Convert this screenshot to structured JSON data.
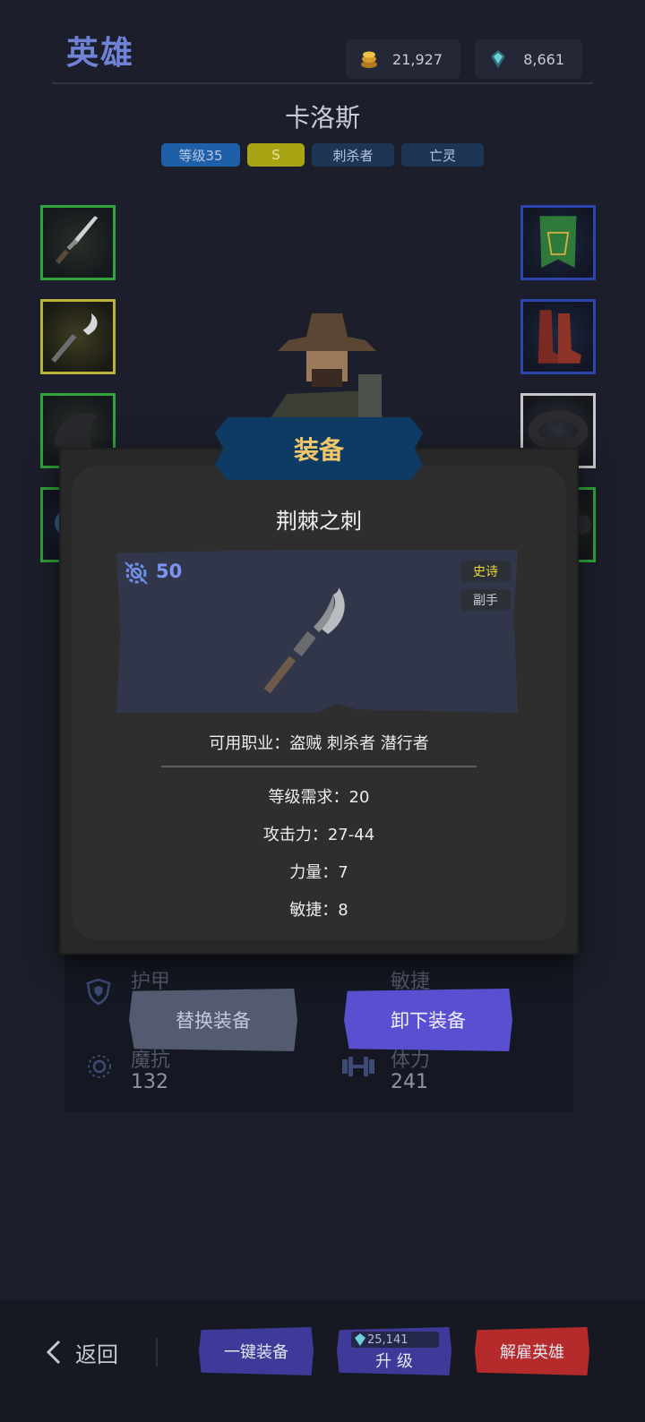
{
  "header": {
    "title": "英雄",
    "gold": "21,927",
    "gems": "8,661"
  },
  "hero": {
    "name": "卡洛斯",
    "tags": [
      "等级35",
      "S",
      "刺杀者",
      "亡灵"
    ]
  },
  "stats_behind": {
    "armor_label": "护甲",
    "agility_label": "敏捷",
    "magic_resist_label": "魔抗",
    "magic_resist_value": "132",
    "stamina_label": "体力",
    "stamina_value": "241"
  },
  "modal": {
    "title": "装备",
    "item_name": "荆棘之刺",
    "item_level": "50",
    "rarity": "史诗",
    "slot_type": "副手",
    "classes": "可用职业：盗贼  刺杀者  潜行者",
    "stats": [
      "等级需求：20",
      "攻击力：27-44",
      "力量：7",
      "敏捷：8"
    ],
    "replace_label": "替换装备",
    "unequip_label": "卸下装备"
  },
  "bottom": {
    "back_label": "返回",
    "equip_all_label": "一键装备",
    "upgrade_cost": "25,141",
    "upgrade_label": "升 级",
    "dismiss_label": "解雇英雄"
  },
  "colors": {
    "accent_blue": "#6f82d6",
    "banner_gold": "#efc66a",
    "unequip_btn": "#5a4fd0",
    "dismiss_btn": "#b52a2a"
  },
  "icons": [
    "gold-coin-icon",
    "gem-icon",
    "level-gear-icon",
    "back-arrow-icon",
    "armor-shield-icon",
    "magic-resist-icon",
    "stamina-dumbbell-icon"
  ]
}
